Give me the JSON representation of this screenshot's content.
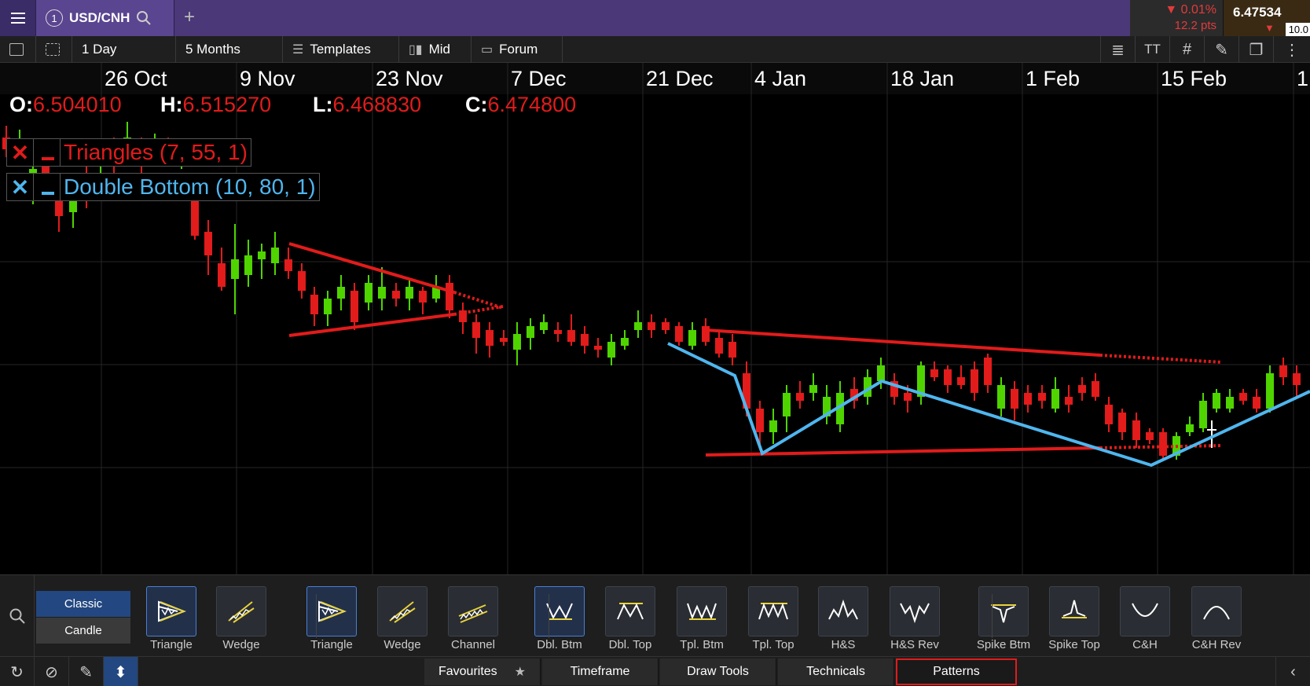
{
  "header": {
    "symbol_number": "1",
    "symbol": "USD/CNH",
    "change_pct": "0.01%",
    "change_pts": "12.2 pts",
    "price": "6.47534",
    "price_sub": "10.0"
  },
  "toolbar": {
    "interval": "1 Day",
    "range": "5 Months",
    "templates": "Templates",
    "price_type": "Mid",
    "forum": "Forum"
  },
  "chart": {
    "dates": [
      "26 Oct",
      "9 Nov",
      "23 Nov",
      "7 Dec",
      "21 Dec",
      "4 Jan",
      "18 Jan",
      "1 Feb",
      "15 Feb",
      "1"
    ],
    "ohlc": {
      "o_label": "O:",
      "o_value": "6.504010",
      "h_label": "H:",
      "h_value": "6.515270",
      "l_label": "L:",
      "l_value": "6.468830",
      "c_label": "C:",
      "c_value": "6.474800"
    },
    "legends": [
      {
        "label": "Triangles (7, 55, 1)",
        "color": "#e21b1b"
      },
      {
        "label": "Double Bottom (10, 80, 1)",
        "color": "#4fb6ee"
      }
    ],
    "colors": {
      "up": "#4fd400",
      "down": "#e21b1b",
      "triangle": "#e21b1b",
      "double_bottom": "#4fb6ee"
    }
  },
  "panel": {
    "style_buttons": [
      "Classic",
      "Candle"
    ],
    "patterns": [
      {
        "label": "Triangle",
        "icon": "triangle-icon",
        "selected": true
      },
      {
        "label": "Wedge",
        "icon": "wedge-icon",
        "selected": false
      },
      {
        "label": "Triangle",
        "icon": "triangle-icon",
        "selected": true
      },
      {
        "label": "Wedge",
        "icon": "wedge-icon",
        "selected": false
      },
      {
        "label": "Channel",
        "icon": "channel-icon",
        "selected": false
      },
      {
        "label": "Dbl. Btm",
        "icon": "double-bottom-icon",
        "selected": true
      },
      {
        "label": "Dbl. Top",
        "icon": "double-top-icon",
        "selected": false
      },
      {
        "label": "Tpl. Btm",
        "icon": "triple-bottom-icon",
        "selected": false
      },
      {
        "label": "Tpl. Top",
        "icon": "triple-top-icon",
        "selected": false
      },
      {
        "label": "H&S",
        "icon": "head-shoulders-icon",
        "selected": false
      },
      {
        "label": "H&S Rev",
        "icon": "head-shoulders-rev-icon",
        "selected": false
      },
      {
        "label": "Spike Btm",
        "icon": "spike-bottom-icon",
        "selected": false
      },
      {
        "label": "Spike Top",
        "icon": "spike-top-icon",
        "selected": false
      },
      {
        "label": "C&H",
        "icon": "cup-handle-icon",
        "selected": false
      },
      {
        "label": "C&H Rev",
        "icon": "cup-handle-rev-icon",
        "selected": false
      }
    ]
  },
  "tabs": [
    {
      "label": "Favourites",
      "active": false
    },
    {
      "label": "Timeframe",
      "active": false
    },
    {
      "label": "Draw Tools",
      "active": false
    },
    {
      "label": "Technicals",
      "active": false
    },
    {
      "label": "Patterns",
      "active": true
    }
  ]
}
